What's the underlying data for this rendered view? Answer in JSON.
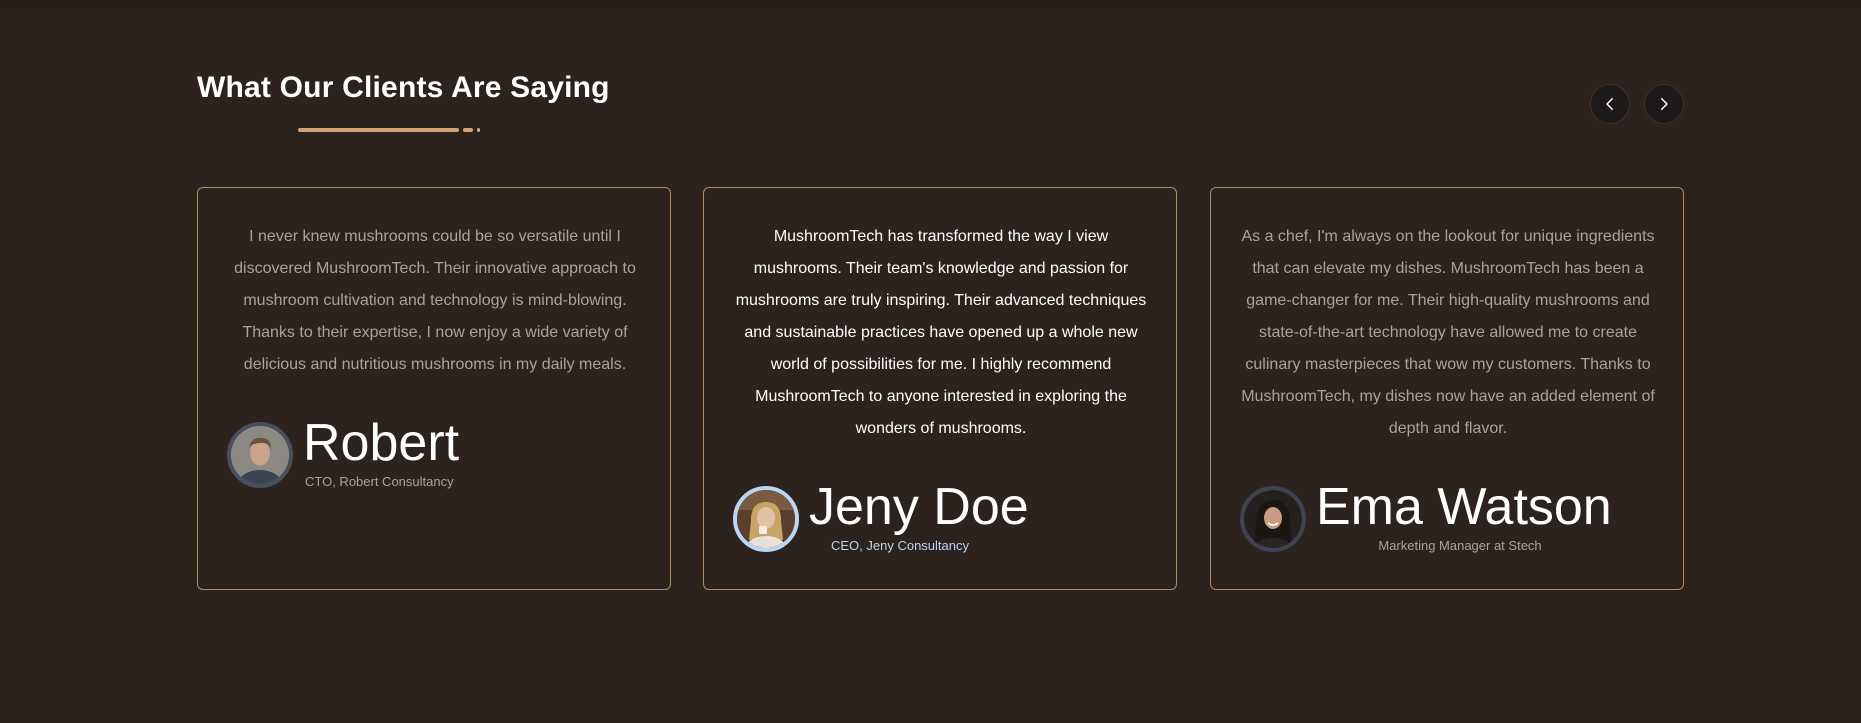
{
  "section": {
    "heading": "What Our Clients Are Saying"
  },
  "navigation": {
    "prev_icon": "chevron-left-icon",
    "next_icon": "chevron-right-icon"
  },
  "colors": {
    "background": "#2c231e",
    "accent": "#d6a376",
    "card_border": "#b38b62",
    "highlight_title": "#b9d6f2"
  },
  "testimonials": [
    {
      "quote": "I never knew mushrooms could be so versatile until I discovered MushroomTech. Their innovative approach to mushroom cultivation and technology is mind-blowing. Thanks to their expertise, I now enjoy a wide variety of delicious and nutritious mushrooms in my daily meals.",
      "name": "Robert",
      "title": "CTO, Robert Consultancy"
    },
    {
      "quote": "MushroomTech has transformed the way I view mushrooms. Their team's knowledge and passion for mushrooms are truly inspiring. Their advanced techniques and sustainable practices have opened up a whole new world of possibilities for me. I highly recommend MushroomTech to anyone interested in exploring the wonders of mushrooms.",
      "name": "Jeny Doe",
      "title": "CEO, Jeny Consultancy"
    },
    {
      "quote": "As a chef, I'm always on the lookout for unique ingredients that can elevate my dishes. MushroomTech has been a game-changer for me. Their high-quality mushrooms and state-of-the-art technology have allowed me to create culinary masterpieces that wow my customers. Thanks to MushroomTech, my dishes now have an added element of depth and flavor.",
      "name": "Ema Watson",
      "title": "Marketing Manager at Stech"
    }
  ]
}
